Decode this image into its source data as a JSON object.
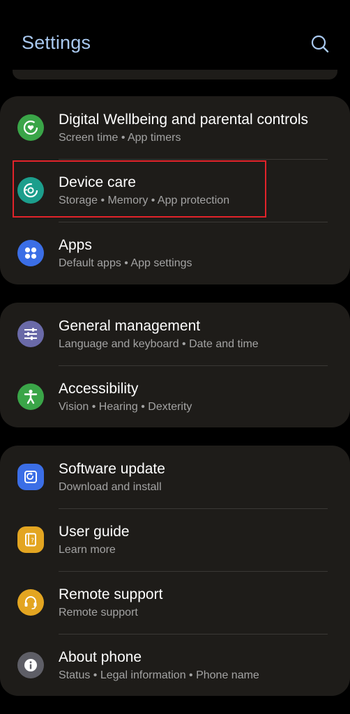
{
  "header": {
    "title": "Settings",
    "search_icon": "search-icon"
  },
  "colors": {
    "background": "#000000",
    "card": "#1e1c19",
    "title": "#a9c9f0",
    "subtitle": "#a3a3a3",
    "highlight": "#e2232a"
  },
  "groups": [
    {
      "items": [
        {
          "title": "Digital Wellbeing and parental controls",
          "subtitle": "Screen time  •  App timers",
          "icon": "digital-wellbeing-icon",
          "icon_color": "#3aa548"
        },
        {
          "title": "Device care",
          "subtitle": "Storage  •  Memory  •  App protection",
          "icon": "device-care-icon",
          "icon_color": "#1c9e8c"
        },
        {
          "title": "Apps",
          "subtitle": "Default apps  •  App settings",
          "icon": "apps-icon",
          "icon_color": "#3b6ee6"
        }
      ]
    },
    {
      "items": [
        {
          "title": "General management",
          "subtitle": "Language and keyboard  •  Date and time",
          "icon": "general-management-icon",
          "icon_color": "#6a6aa8"
        },
        {
          "title": "Accessibility",
          "subtitle": "Vision  •  Hearing  •  Dexterity",
          "icon": "accessibility-icon",
          "icon_color": "#3aa548"
        }
      ]
    },
    {
      "items": [
        {
          "title": "Software update",
          "subtitle": "Download and install",
          "icon": "software-update-icon",
          "icon_color": "#3b6ee6"
        },
        {
          "title": "User guide",
          "subtitle": "Learn more",
          "icon": "user-guide-icon",
          "icon_color": "#e3a521"
        },
        {
          "title": "Remote support",
          "subtitle": "Remote support",
          "icon": "remote-support-icon",
          "icon_color": "#e3a521"
        },
        {
          "title": "About phone",
          "subtitle": "Status  •  Legal information  •  Phone name",
          "icon": "about-phone-icon",
          "icon_color": "#5e5e66"
        }
      ]
    }
  ]
}
